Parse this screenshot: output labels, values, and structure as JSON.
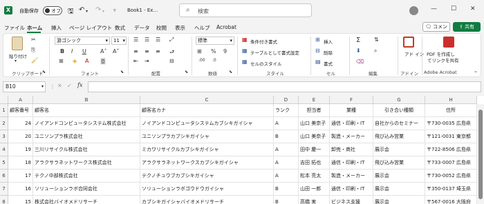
{
  "titlebar": {
    "app_icon": "excel-icon",
    "autosave_label": "自動保存",
    "autosave_state": "オフ",
    "title": "Book1 - Ex…",
    "search_placeholder": "検索"
  },
  "tabs": [
    "ファイル",
    "ホーム",
    "挿入",
    "ページ レイアウト",
    "数式",
    "データ",
    "校閲",
    "表示",
    "ヘルプ",
    "Acrobat"
  ],
  "active_tab": "ホーム",
  "comment_label": "コメント",
  "share_label": "共有",
  "ribbon": {
    "clipboard": {
      "paste": "貼り付け",
      "label": "クリップボード"
    },
    "font": {
      "name": "游ゴシック",
      "size": "11",
      "label": "フォント"
    },
    "alignment": {
      "label": "配置"
    },
    "number": {
      "format": "標準",
      "label": "数値"
    },
    "styles": {
      "conditional": "条件付き書式",
      "table": "テーブルとして書式設定",
      "cell": "セルのスタイル",
      "label": "スタイル"
    },
    "cells": {
      "insert": "挿入",
      "delete": "削除",
      "format": "書式",
      "label": "セル"
    },
    "editing": {
      "label": "編集"
    },
    "addin": {
      "button": "アド イン",
      "label": "アドイン"
    },
    "acrobat": {
      "button_line1": "PDF を作成し",
      "button_line2": "てリンクを共有",
      "label": "Adobe Acrobat"
    }
  },
  "formula_bar": {
    "name_box": "B10",
    "fx": "fx",
    "value": ""
  },
  "sheet": {
    "columns": [
      "A",
      "B",
      "C",
      "D",
      "E",
      "F",
      "G",
      "H"
    ],
    "row_numbers": [
      "1",
      "2",
      "3",
      "4",
      "5",
      "6",
      "7",
      "8"
    ],
    "header_row": [
      "顧客番号",
      "顧客名",
      "顧客名カナ",
      "ランク",
      "担当者",
      "業種",
      "引き合い種類",
      "住所"
    ],
    "rows": [
      [
        "24",
        "ノイアンドコンピュータシステム株式会社",
        "ノイアンドコンピュータシステムカブシキガイシャ",
        "A",
        "山口 美奈子",
        "通信・印刷・IT",
        "自社からのセミナー",
        "〒730-0035 広島県"
      ],
      [
        "20",
        "ユニソンプラ株式会社",
        "ユニソンプラカブシキガイシャ",
        "B",
        "山口 美奈子",
        "製造・メーカー",
        "飛び込み営業",
        "〒121-0031 東京都"
      ],
      [
        "19",
        "三川リサイクル株式会社",
        "ミカワリサイクルカブシキガイシャ",
        "A",
        "田中 慶一",
        "卸売・商社",
        "展示会",
        "〒722-8506 広島県"
      ],
      [
        "18",
        "アラクサラネットワークス株式会社",
        "アラクサラネットワークスカブシキガイシャ",
        "A",
        "吉田 拓也",
        "通信・印刷・IT",
        "飛び込み営業",
        "〒733-0007 広島県"
      ],
      [
        "17",
        "テクノ中部株式会社",
        "テクノチュウブカブシキガイシャ",
        "A",
        "松本 亮太",
        "製造・メーカー",
        "展示会",
        "〒730-0052 広島県"
      ],
      [
        "16",
        "ソリューションラボ合同会社",
        "ソリューションラボゴウドウガイシャ",
        "B",
        "山田 一郎",
        "通信・印刷・IT",
        "展示会",
        "〒350-0137 埼玉県"
      ],
      [
        "15",
        "株式会社バイオメドリサーチ",
        "カブシキガイシャバイオメドリサーチ",
        "B",
        "高橋 実",
        "ビジネス支援",
        "展示会",
        "〒567-0016 大阪府"
      ]
    ]
  }
}
